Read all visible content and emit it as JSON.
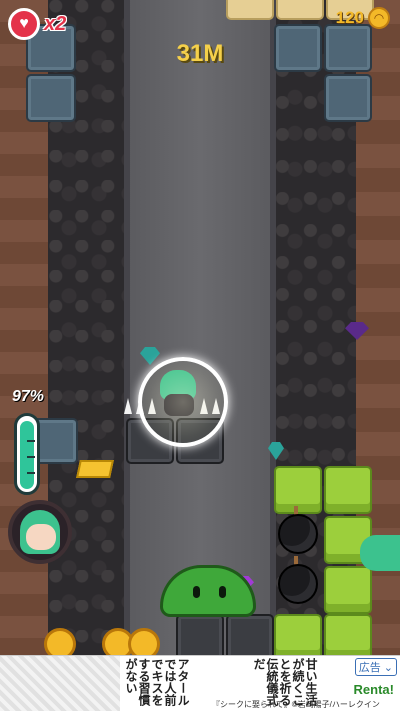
{
  "hud": {
    "lives_icon": "heart-icon",
    "lives_text": "x2",
    "coin_count": "120",
    "coin_icon": "coin-icon",
    "depth_text": "31M"
  },
  "gauge": {
    "label": "97%",
    "level": 0.97
  },
  "colors": {
    "life_red": "#e4334a",
    "depth_yellow": "#f5d04a",
    "gauge_green": "#2fc59a",
    "grass_green": "#9ccf3c",
    "stone_blue": "#4f6676"
  },
  "ad": {
    "tag": "広告 ⌄",
    "col1": "アタールでは人前でキスをする習慣がない",
    "col2": "甘い生活が続くことを祈る伝統儀式だ",
    "brand": "Renta!",
    "credit": "『シークに娶られて』©岩崎陽子/ハーレクイン"
  }
}
